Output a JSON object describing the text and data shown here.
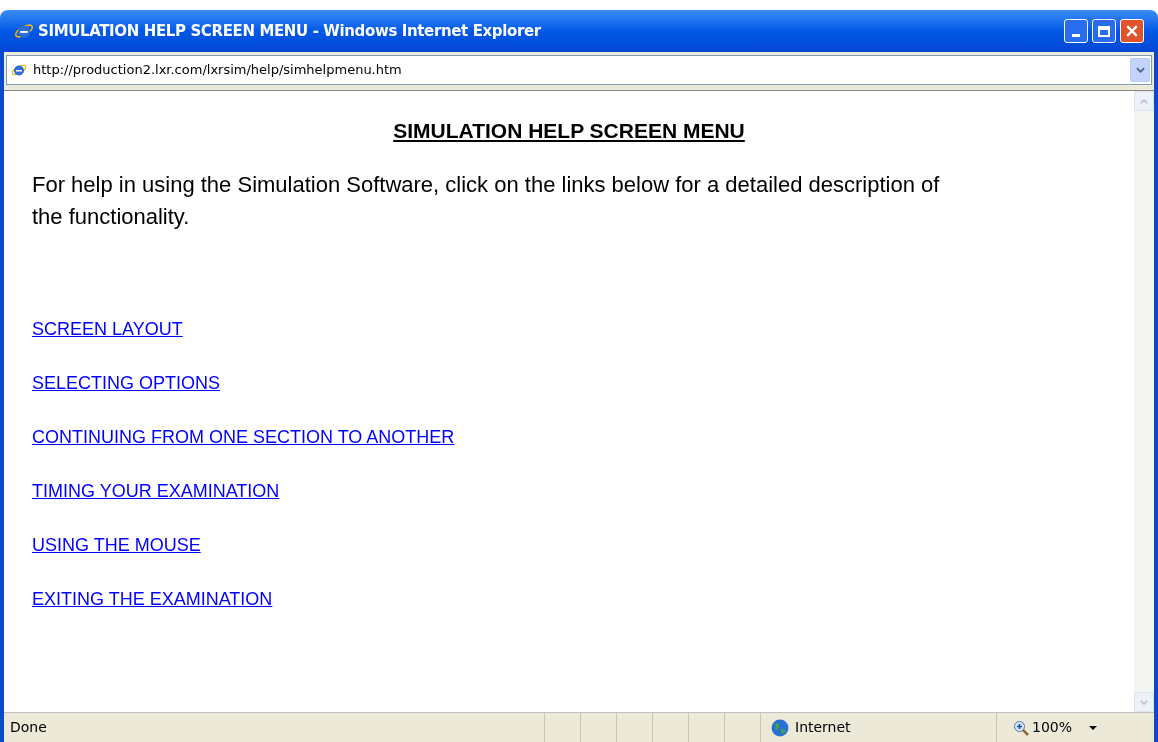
{
  "window": {
    "title": "SIMULATION HELP SCREEN MENU - Windows Internet Explorer"
  },
  "address_bar": {
    "url": "http://production2.lxr.com/lxrsim/help/simhelpmenu.htm"
  },
  "page": {
    "heading": "SIMULATION HELP SCREEN MENU",
    "intro": "For help in using the Simulation Software, click on the links below for a detailed description of the functionality.",
    "links": [
      "SCREEN LAYOUT",
      "SELECTING OPTIONS",
      "CONTINUING FROM ONE SECTION TO ANOTHER",
      "TIMING YOUR EXAMINATION",
      "USING THE MOUSE",
      "EXITING THE EXAMINATION"
    ]
  },
  "status_bar": {
    "status": "Done",
    "zone": "Internet",
    "zoom": "100%"
  }
}
